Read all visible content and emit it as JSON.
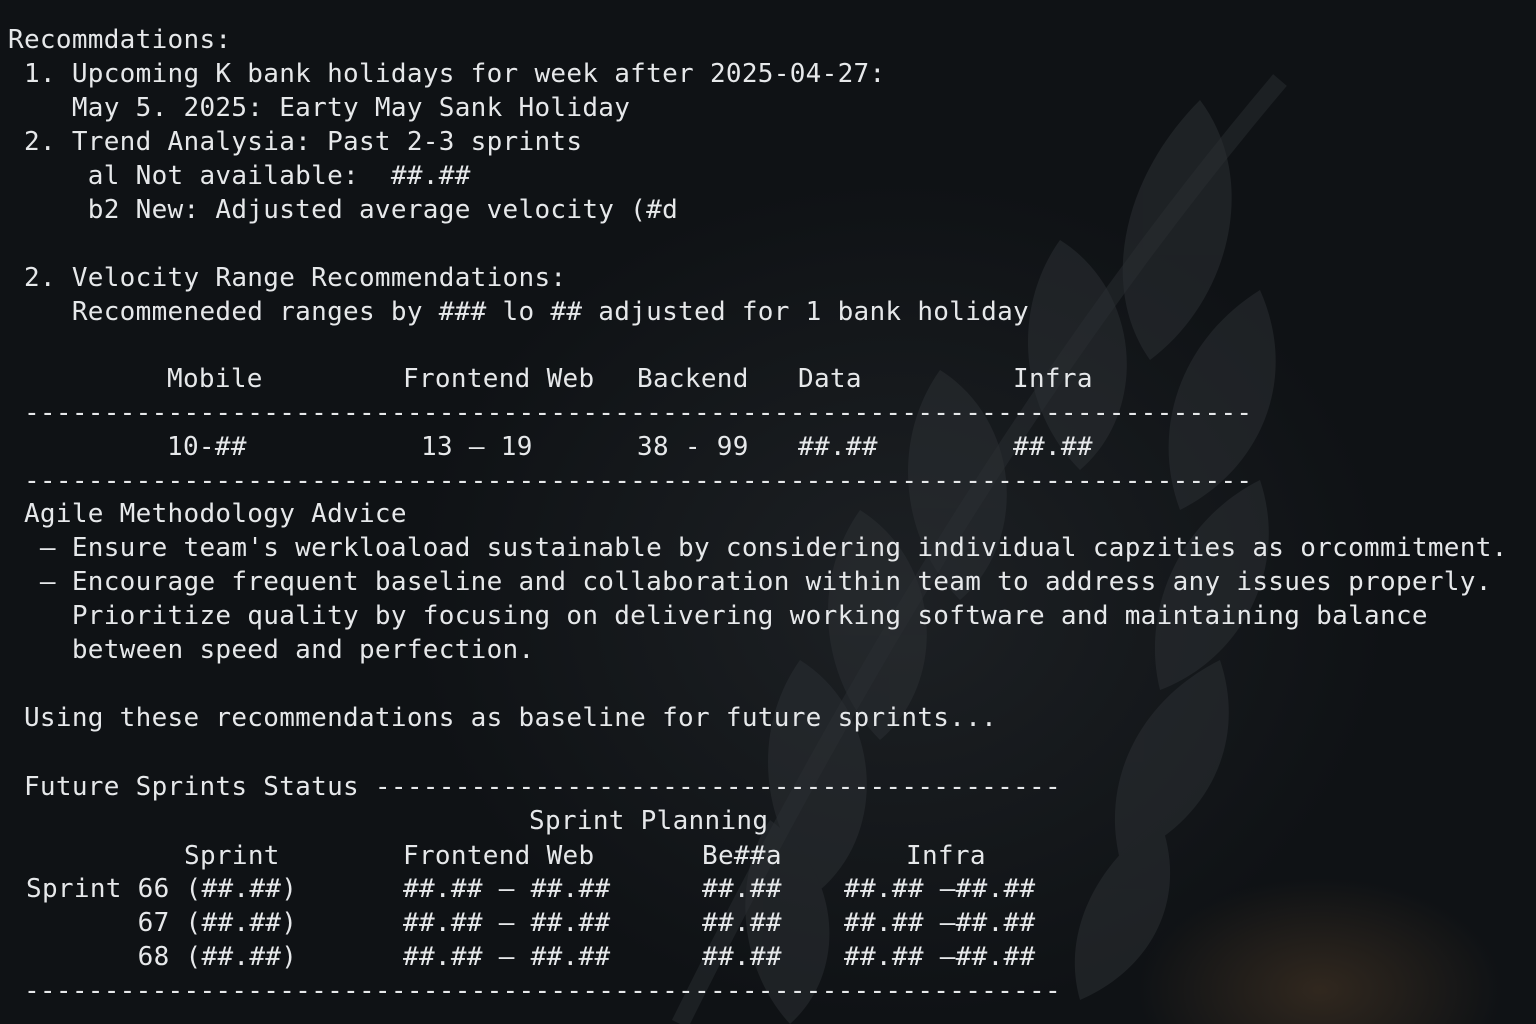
{
  "recommendations": {
    "heading": "Recommdations:",
    "item1_title": " 1. Upcoming K bank holidays for week after 2025-04-27:",
    "item1_detail": "    May 5. 2025: Earty May Sank Holiday",
    "item2_title": " 2. Trend Analysia: Past 2-3 sprints",
    "item2_a": "     al Not available:  ##.##",
    "item2_b": "     b2 New: Adjusted average velocity (#d",
    "item3_title": " 2. Velocity Range Recommendations:",
    "item3_detail": "    Recommeneded ranges by ### lo ## adjusted for 1 bank holiday"
  },
  "velocity_table": {
    "headers": [
      "Mobile",
      "Frontend Web",
      "Backend",
      "Data",
      "Infra"
    ],
    "values": [
      "10-##",
      "13 — 19",
      "38 - 99",
      "##.##",
      "##.##"
    ],
    "divider": " -----------------------------------------------------------------------------"
  },
  "agile_advice": {
    "heading": " Agile Methodology Advice",
    "bullet1": "  – Ensure team's werkloaload sustainable by considering individual capzities as orcommitment.",
    "bullet2": "  – Encourage frequent baseline and collaboration within team to address any issues properly.",
    "bullet2_cont1": "    Prioritize quality by focusing on delivering working software and maintaining balance",
    "bullet2_cont2": "    between speed and perfection."
  },
  "baseline_note": " Using these recommendations as baseline for future sprints...",
  "future_sprints": {
    "heading": " Future Sprints Status -------------------------------------------",
    "subheading": "Sprint Planning",
    "headers": [
      "Sprint",
      "Frontend Web",
      "Be##a",
      "Infra"
    ],
    "rows": [
      [
        "Sprint 66 (##.##)",
        "##.## – ##.##",
        "##.##",
        "##.## –##.##"
      ],
      [
        "       67 (##.##)",
        "##.## – ##.##",
        "##.##",
        "##.## –##.##"
      ],
      [
        "       68 (##.##)",
        "##.## – ##.##",
        "##.##",
        "##.## –##.##"
      ]
    ],
    "divider": " -----------------------------------------------------------------"
  }
}
